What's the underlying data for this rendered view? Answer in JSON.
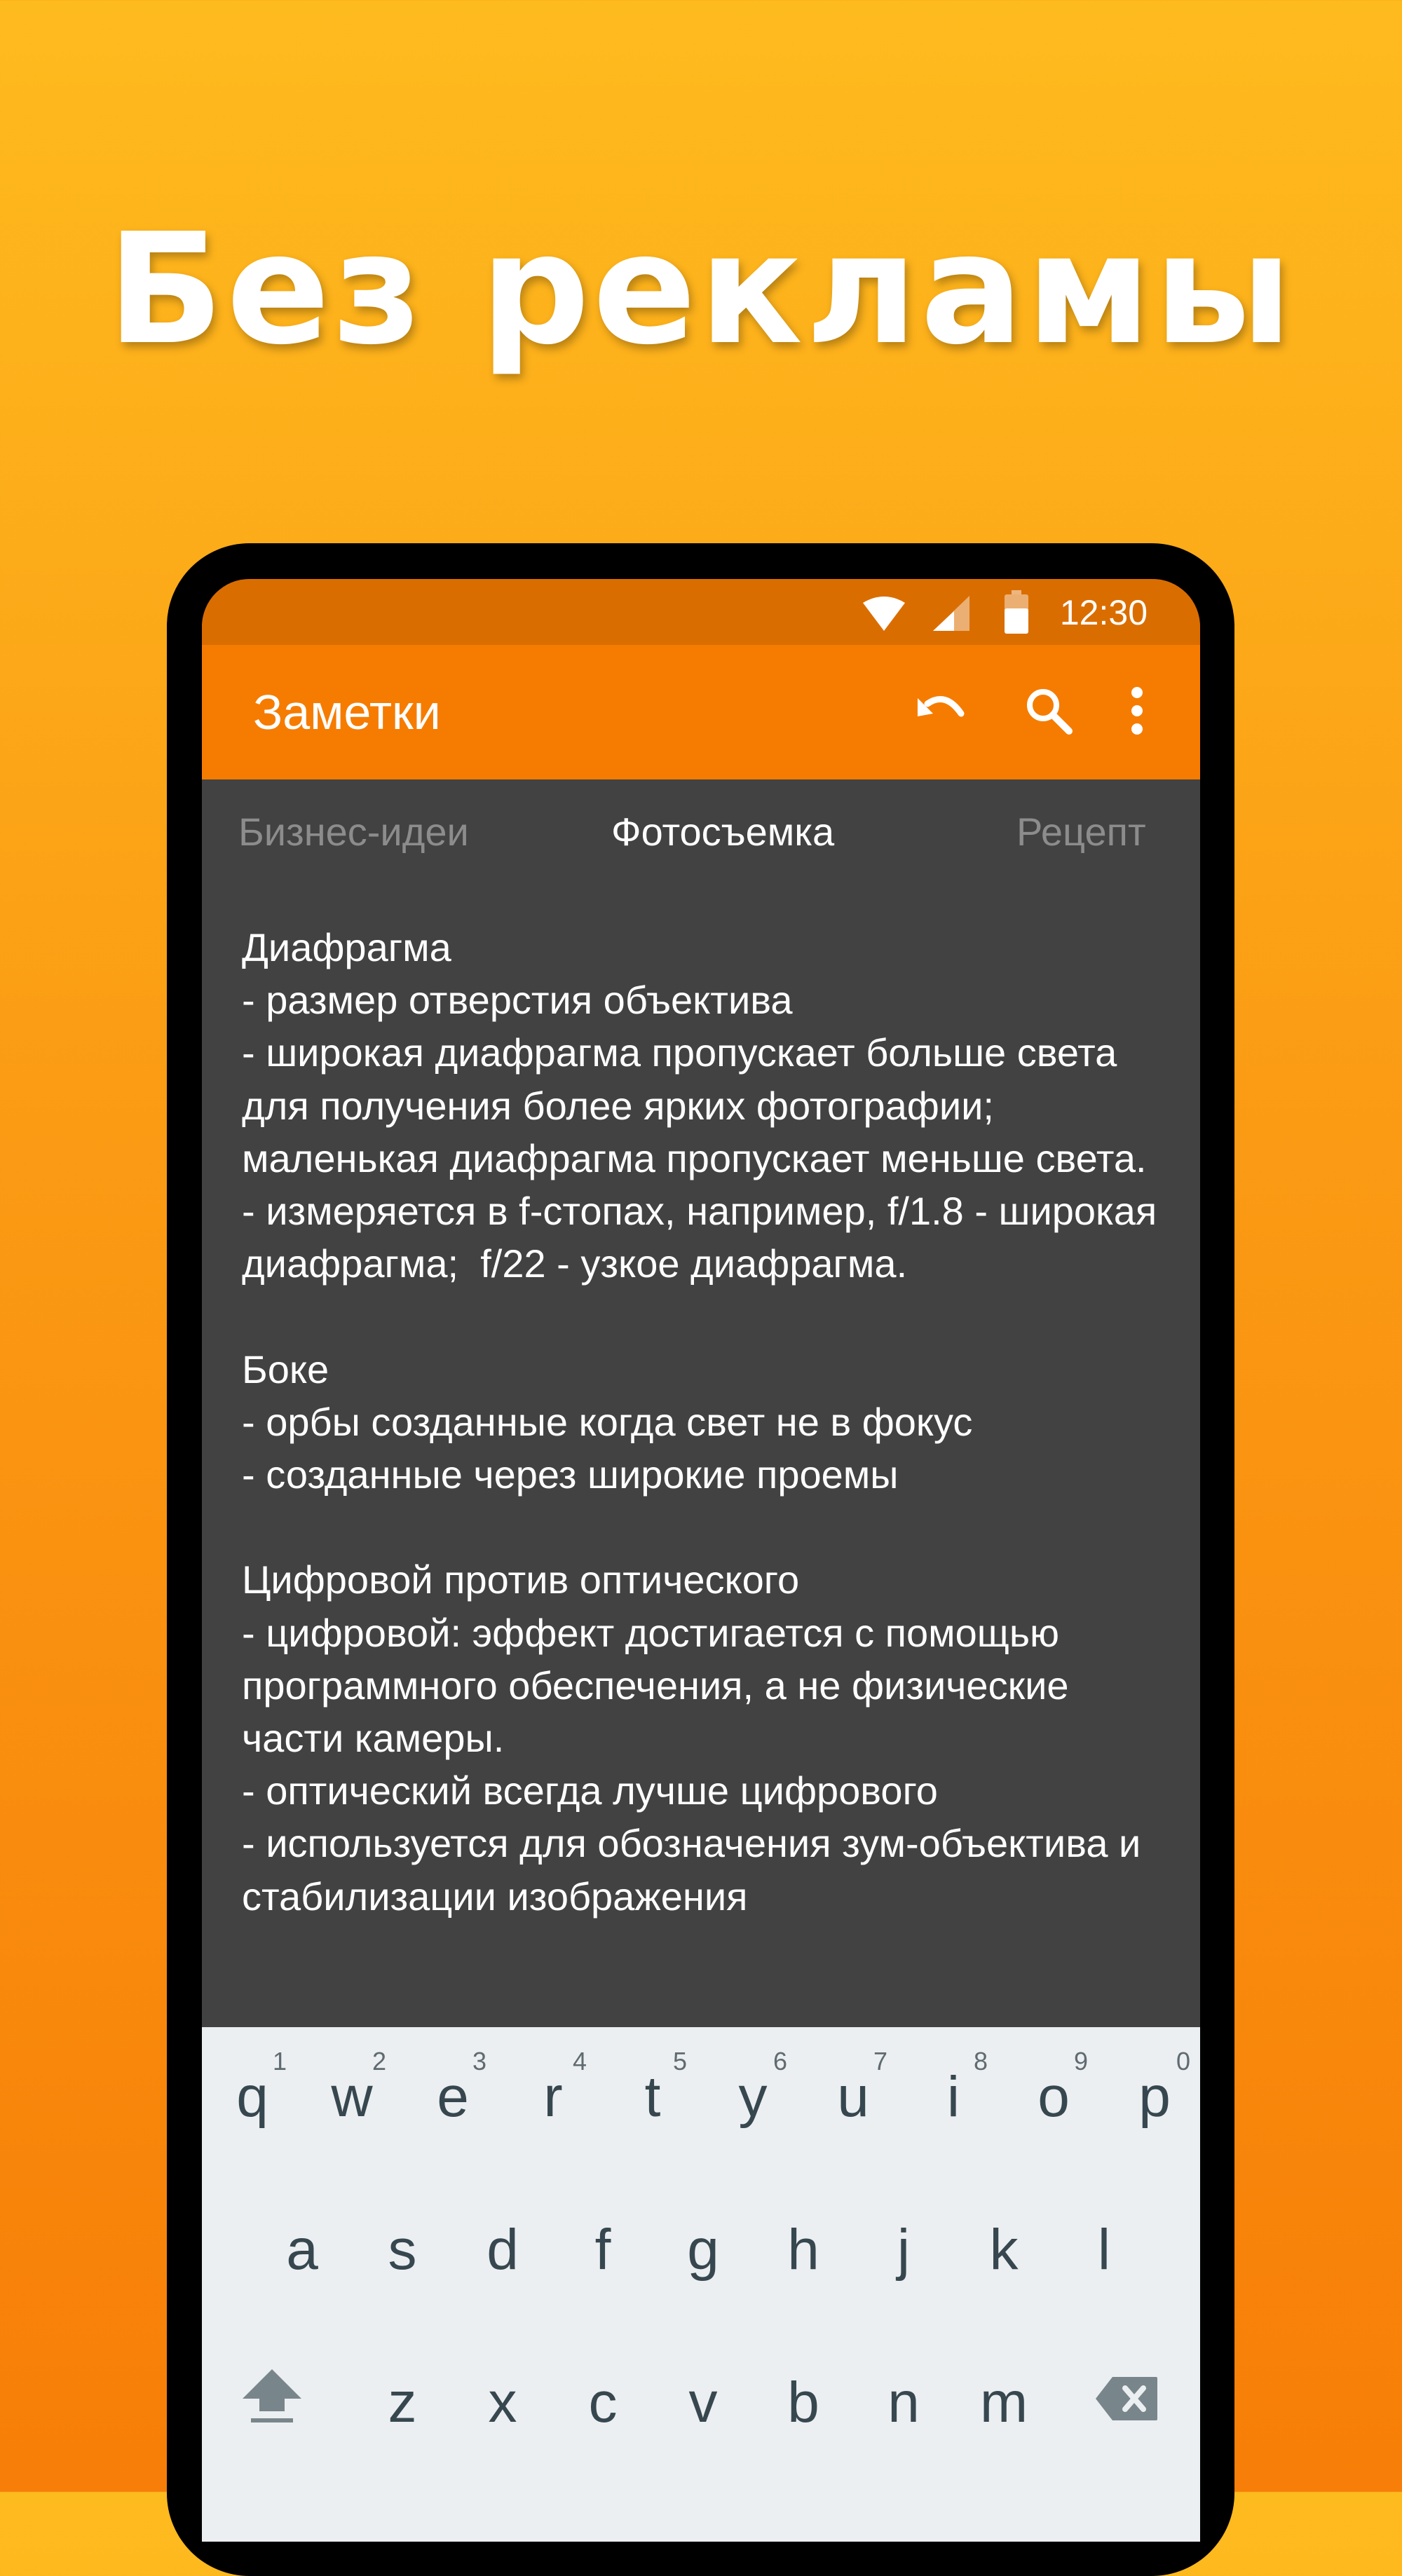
{
  "promo": {
    "headline": "Без рекламы"
  },
  "status_bar": {
    "time": "12:30",
    "icons": [
      "wifi-icon",
      "cellular-signal-icon",
      "battery-icon"
    ]
  },
  "app_bar": {
    "title": "Заметки",
    "actions": [
      "undo-icon",
      "search-icon",
      "more-vert-icon"
    ]
  },
  "tabs": [
    {
      "label": "Бизнес-идеи",
      "active": false
    },
    {
      "label": "Фотосъемка",
      "active": true
    },
    {
      "label": "Рецепт",
      "active": false
    }
  ],
  "note": {
    "text": "Диафрагма\n- размер отверстия объектива\n- широкая диафрагма пропускает больше света для получения более ярких фотографии; маленькая диафрагма пропускает меньше света.\n- измеряется в f-стопах, например, f/1.8 - широкая диафрагма;  f/22 - узкое диафрагма.\n\nБоке\n- орбы созданные когда свет не в фокус\n- созданные через широкие проемы\n\nЦифровой против оптического\n- цифровой: эффект достигается с помощью программного обеспечения, а не физические части камеры.\n- оптический всегда лучше цифрового\n- используется для обозначения зум-объектива и стабилизации изображения"
  },
  "keyboard": {
    "row1": [
      "q",
      "w",
      "e",
      "r",
      "t",
      "y",
      "u",
      "i",
      "o",
      "p"
    ],
    "row1_hints": [
      "1",
      "2",
      "3",
      "4",
      "5",
      "6",
      "7",
      "8",
      "9",
      "0"
    ],
    "row2": [
      "a",
      "s",
      "d",
      "f",
      "g",
      "h",
      "j",
      "k",
      "l"
    ],
    "row3": [
      "z",
      "x",
      "c",
      "v",
      "b",
      "n",
      "m"
    ],
    "icons": [
      "shift-icon",
      "backspace-icon"
    ],
    "colors": {
      "background": "#ECEFF1",
      "key_text": "#37474F"
    }
  },
  "colors": {
    "app_bar": "#F57C00",
    "status_bar": "#DA6D00",
    "note_background": "#424242",
    "promo_gradient_top": "#FEBB1E",
    "promo_gradient_bottom": "#F77E08"
  }
}
